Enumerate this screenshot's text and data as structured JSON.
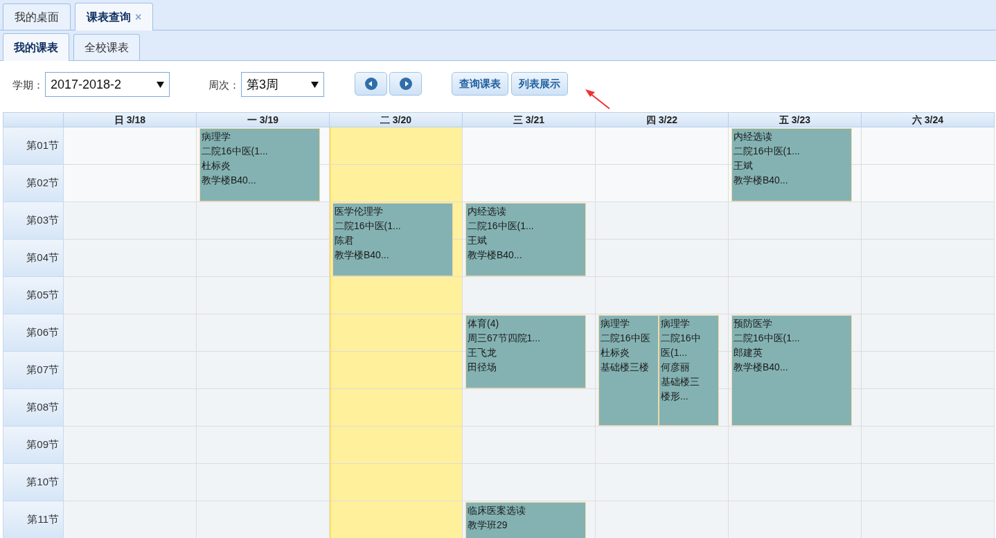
{
  "tabs": [
    {
      "label": "我的桌面",
      "selected": false
    },
    {
      "label": "课表查询",
      "selected": true,
      "close": "×"
    }
  ],
  "subtabs": [
    {
      "label": "我的课表",
      "selected": true
    },
    {
      "label": "全校课表",
      "selected": false
    }
  ],
  "filters": [
    {
      "label": "学期：",
      "value": "2017-2018-2"
    },
    {
      "label": "周次：",
      "value": "第3周"
    }
  ],
  "nav_buttons": [
    {
      "kind": "previous"
    },
    {
      "kind": "next"
    }
  ],
  "buttons": [
    "查询课表",
    "列表展示"
  ],
  "schedule": {
    "days": [
      {
        "label": "日 3/18",
        "selected": false
      },
      {
        "label": "一 3/19",
        "selected": false
      },
      {
        "label": "二 3/20",
        "selected": true
      },
      {
        "label": "三 3/21",
        "selected": false
      },
      {
        "label": "四 3/22",
        "selected": false
      },
      {
        "label": "五 3/23",
        "selected": false
      },
      {
        "label": "六 3/24",
        "selected": false
      }
    ],
    "periods": [
      {
        "label": "第01节",
        "cells": [
          {},
          {
            "events": [
              {
                "kind": "double",
                "lines": [
                  "病理学",
                  "二院16中医(1...",
                  "杜标炎",
                  "教学楼B40..."
                ]
              }
            ]
          },
          {},
          {},
          {},
          {
            "events": [
              {
                "kind": "double",
                "lines": [
                  "内经选读",
                  "二院16中医(1...",
                  "王斌",
                  "教学楼B40..."
                ]
              }
            ]
          },
          {}
        ]
      },
      {
        "label": "第02节",
        "cells": [
          {},
          {},
          {},
          {},
          {},
          {},
          {}
        ]
      },
      {
        "label": "第03节",
        "cells": [
          {},
          {},
          {
            "events": [
              {
                "kind": "double",
                "lines": [
                  "医学伦理学",
                  "二院16中医(1...",
                  "陈君",
                  "教学楼B40..."
                ]
              }
            ]
          },
          {
            "events": [
              {
                "kind": "double",
                "lines": [
                  "内经选读",
                  "二院16中医(1...",
                  "王斌",
                  "教学楼B40..."
                ]
              }
            ]
          },
          {},
          {},
          {}
        ]
      },
      {
        "label": "第04节",
        "cells": [
          {},
          {},
          {},
          {},
          {},
          {},
          {}
        ]
      },
      {
        "label": "第05节",
        "cells": [
          {},
          {},
          {},
          {},
          {},
          {},
          {}
        ]
      },
      {
        "label": "第06节",
        "cells": [
          {},
          {},
          {},
          {
            "events": [
              {
                "kind": "double",
                "lines": [
                  "体育(4)",
                  "周三67节四院1...",
                  "王飞龙",
                  "田径场"
                ]
              }
            ]
          },
          {
            "events": [
              {
                "kind": "triple",
                "lines": [
                  "病理学",
                  "二院16中医",
                  "杜标炎",
                  "基础楼三楼"
                ]
              },
              {
                "kind": "triple",
                "lines": [
                  "病理学",
                  "二院16中",
                  "医(1...",
                  "何彦丽",
                  "基础楼三",
                  "楼形..."
                ]
              }
            ]
          },
          {
            "events": [
              {
                "kind": "triple",
                "lines": [
                  "预防医学",
                  "二院16中医(1...",
                  "郎建英",
                  "教学楼B40..."
                ]
              }
            ]
          },
          {}
        ]
      },
      {
        "label": "第07节",
        "cells": [
          {},
          {},
          {},
          {},
          {},
          {},
          {}
        ]
      },
      {
        "label": "第08节",
        "cells": [
          {},
          {},
          {},
          {},
          {},
          {},
          {}
        ]
      },
      {
        "label": "第09节",
        "cells": [
          {},
          {},
          {},
          {},
          {},
          {},
          {}
        ]
      },
      {
        "label": "第10节",
        "cells": [
          {},
          {},
          {},
          {},
          {},
          {},
          {}
        ]
      },
      {
        "label": "第11节",
        "cells": [
          {},
          {},
          {},
          {
            "events": [
              {
                "kind": "double",
                "lines": [
                  "临床医案选读",
                  "教学班29"
                ]
              }
            ]
          },
          {},
          {},
          {}
        ]
      }
    ]
  }
}
